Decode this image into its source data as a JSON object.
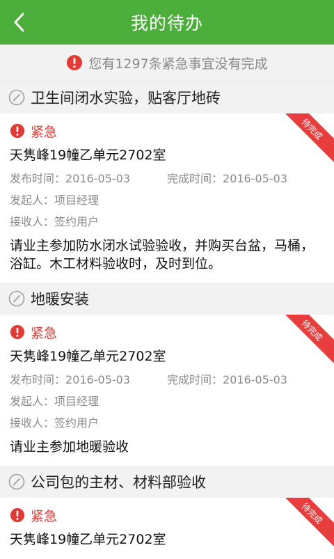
{
  "header": {
    "title": "我的待办"
  },
  "alert": {
    "text": "您有1297条紧急事宜没有完成"
  },
  "tasks": [
    {
      "section_title": "卫生间闭水实验，贴客厅地砖",
      "ribbon": "待完成",
      "urgency": "紧急",
      "address": "天隽峰19幢乙单元2702室",
      "publish_label": "发布时间：",
      "publish_date": "2016-05-03",
      "finish_label": "完成时间：",
      "finish_date": "2016-05-03",
      "initiator_label": "发起人：",
      "initiator": "项目经理",
      "receiver_label": "接收人：",
      "receiver": "签约用户",
      "description": "请业主参加防水闭水试验验收，并购买台盆，马桶，浴缸。木工材料验收时，及时到位。"
    },
    {
      "section_title": "地暖安装",
      "ribbon": "待完成",
      "urgency": "紧急",
      "address": "天隽峰19幢乙单元2702室",
      "publish_label": "发布时间：",
      "publish_date": "2016-05-03",
      "finish_label": "完成时间：",
      "finish_date": "2016-05-03",
      "initiator_label": "发起人：",
      "initiator": "项目经理",
      "receiver_label": "接收人：",
      "receiver": "签约用户",
      "description": "请业主参加地暖验收"
    },
    {
      "section_title": "公司包的主材、材料部验收",
      "ribbon": "待完成",
      "urgency": "紧急",
      "address": "天隽峰19幢乙单元2702室"
    }
  ],
  "colors": {
    "header": "#4caf3c",
    "urgent": "#e53935",
    "ribbon": "#e83d3d"
  },
  "icons": {
    "back": "chevron-left-icon",
    "alert": "exclamation-circle-icon",
    "section": "pencil-circle-icon"
  }
}
